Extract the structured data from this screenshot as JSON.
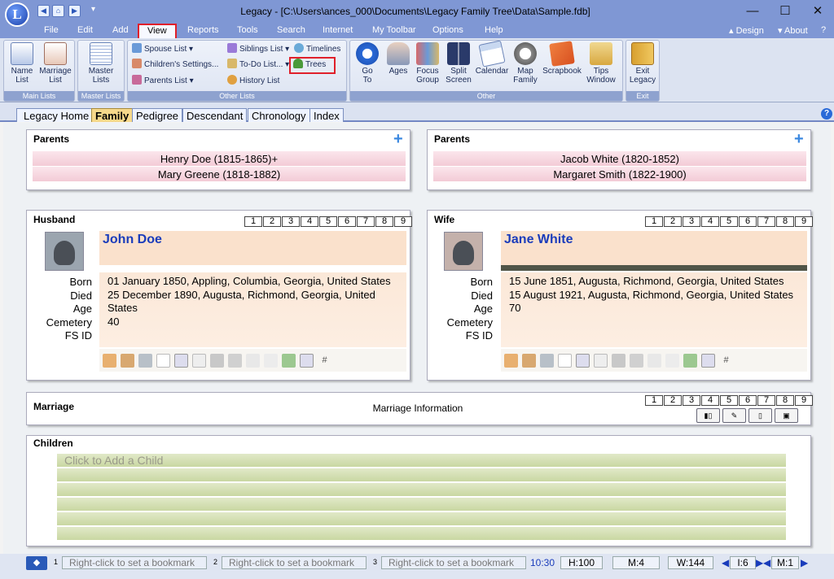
{
  "window": {
    "title": "Legacy - [C:\\Users\\ances_000\\Documents\\Legacy Family Tree\\Data\\Sample.fdb]",
    "minimize": "—",
    "maximize": "☐",
    "close": "✕",
    "logo": "L"
  },
  "menu": [
    "File",
    "Edit",
    "Add",
    "View",
    "Reports",
    "Tools",
    "Search",
    "Internet",
    "My Toolbar",
    "Options",
    "Help"
  ],
  "menu_right": {
    "design": "Design",
    "about": "About"
  },
  "ribbon": {
    "main_lists": {
      "label": "Main Lists",
      "name_list": "Name\nList",
      "marriage_list": "Marriage\nList"
    },
    "master_lists": {
      "label": "Master Lists",
      "master": "Master\nLists"
    },
    "other_lists": {
      "label": "Other Lists",
      "spouse": "Spouse List",
      "children_settings": "Children's Settings...",
      "parents": "Parents List",
      "siblings": "Siblings List",
      "todo": "To-Do List...",
      "history": "History List",
      "timelines": "Timelines",
      "trees": "Trees"
    },
    "other": {
      "label": "Other",
      "goto": "Go\nTo",
      "ages": "Ages",
      "focus": "Focus\nGroup",
      "split": "Split\nScreen",
      "calendar": "Calendar",
      "map": "Map\nFamily",
      "scrapbook": "Scrapbook",
      "tips": "Tips\nWindow"
    },
    "exit": {
      "label": "Exit",
      "exit": "Exit\nLegacy"
    }
  },
  "tabs": [
    "Legacy Home",
    "Family",
    "Pedigree",
    "Descendant",
    "Chronology",
    "Index"
  ],
  "help_icon": "?",
  "husband_parents": {
    "title": "Parents",
    "father": "Henry Doe (1815-1865)+",
    "mother": "Mary Greene (1818-1882)"
  },
  "wife_parents": {
    "title": "Parents",
    "father": "Jacob White (1820-1852)",
    "mother": "Margaret Smith (1822-1900)"
  },
  "nums": [
    "1",
    "2",
    "3",
    "4",
    "5",
    "6",
    "7",
    "8",
    "9"
  ],
  "husband": {
    "title": "Husband",
    "name": "John Doe",
    "born": "01 January 1850, Appling, Columbia, Georgia, United States",
    "died": "25 December 1890, Augusta, Richmond, Georgia, United States",
    "age": "40",
    "cemetery": "",
    "fsid": ""
  },
  "wife": {
    "title": "Wife",
    "name": "Jane White",
    "born": "15 June 1851, Augusta, Richmond, Georgia, United States",
    "died": "15 August 1921, Augusta, Richmond, Georgia, United States",
    "age": "70",
    "cemetery": "",
    "fsid": ""
  },
  "labels": {
    "born": "Born",
    "died": "Died",
    "age": "Age",
    "cemetery": "Cemetery",
    "fsid": "FS ID"
  },
  "marriage": {
    "title": "Marriage",
    "info": "Marriage Information"
  },
  "children": {
    "title": "Children",
    "add": "Click to Add a Child"
  },
  "status": {
    "bm1": "Right-click to set a bookmark",
    "bm2": "Right-click to set a bookmark",
    "bm3": "Right-click to set a bookmark",
    "n1": "1",
    "n2": "2",
    "n3": "3",
    "time": "10:30",
    "h": "H:100",
    "m": "M:4",
    "w": "W:144",
    "i": "I:6",
    "m1": "M:1"
  }
}
